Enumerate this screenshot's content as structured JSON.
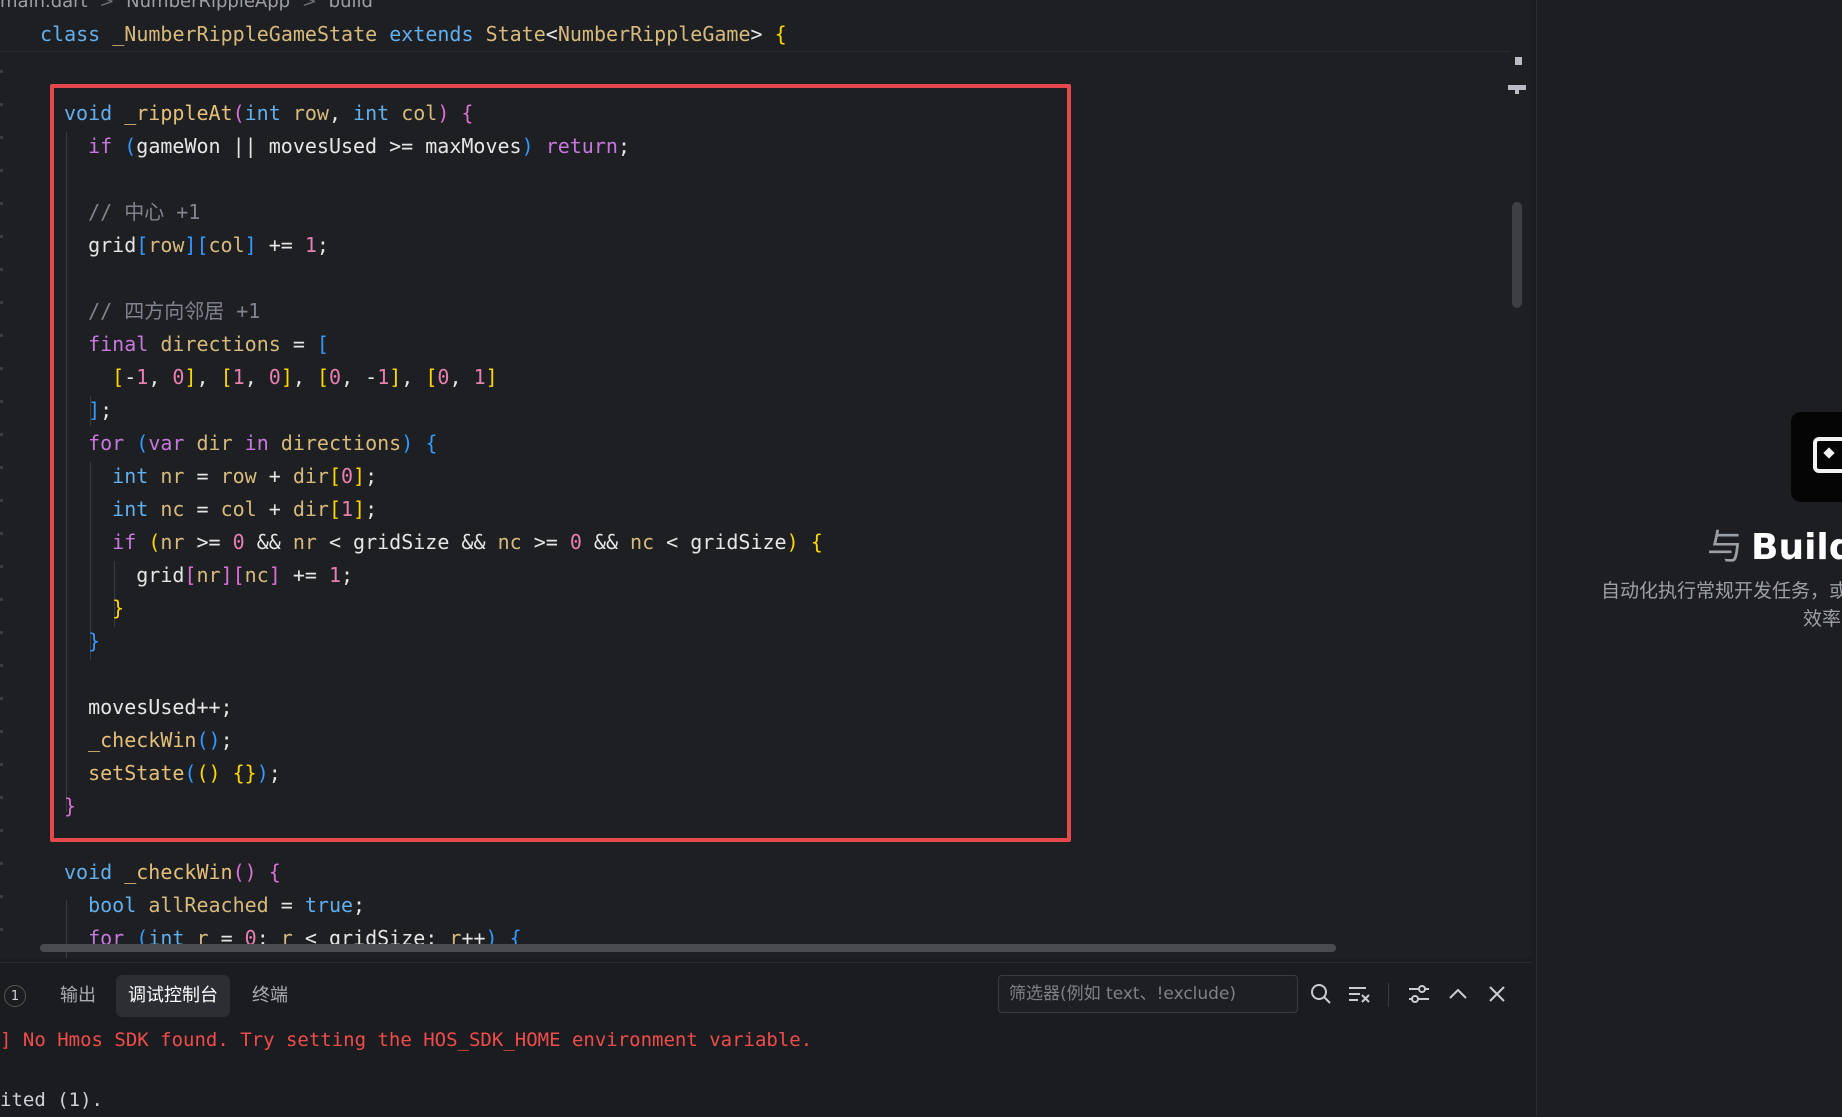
{
  "breadcrumb": {
    "file": "main.dart",
    "sep1": ">",
    "app": "NumberRippleApp",
    "sep2": ">",
    "method": "build"
  },
  "editor": {
    "sticky_header": "class _NumberRippleGameState extends State<NumberRippleGame> {"
  },
  "panel": {
    "badge": "1",
    "tabs": [
      "输出",
      "调试控制台",
      "终端"
    ],
    "active_tab": "调试控制台",
    "filter_placeholder": "筛选器(例如 text、!exclude)",
    "output": [
      "] No Hmos SDK found. Try setting the HOS_SDK_HOME environment variable.",
      "ited (1)."
    ],
    "icons": [
      "search-icon",
      "clear-filter-icon",
      "settings-sliders-icon",
      "chevron-up-icon",
      "close-icon"
    ],
    "error_color": "#f14c4c"
  },
  "right_pane": {
    "title": "Build",
    "title_glyph": "与",
    "desc_line1": "自动化执行常规开发任务，或",
    "desc_line2": "效率"
  },
  "colors": {
    "highlight_border": "#e5484d",
    "editor_bg": "#1e1f22"
  }
}
